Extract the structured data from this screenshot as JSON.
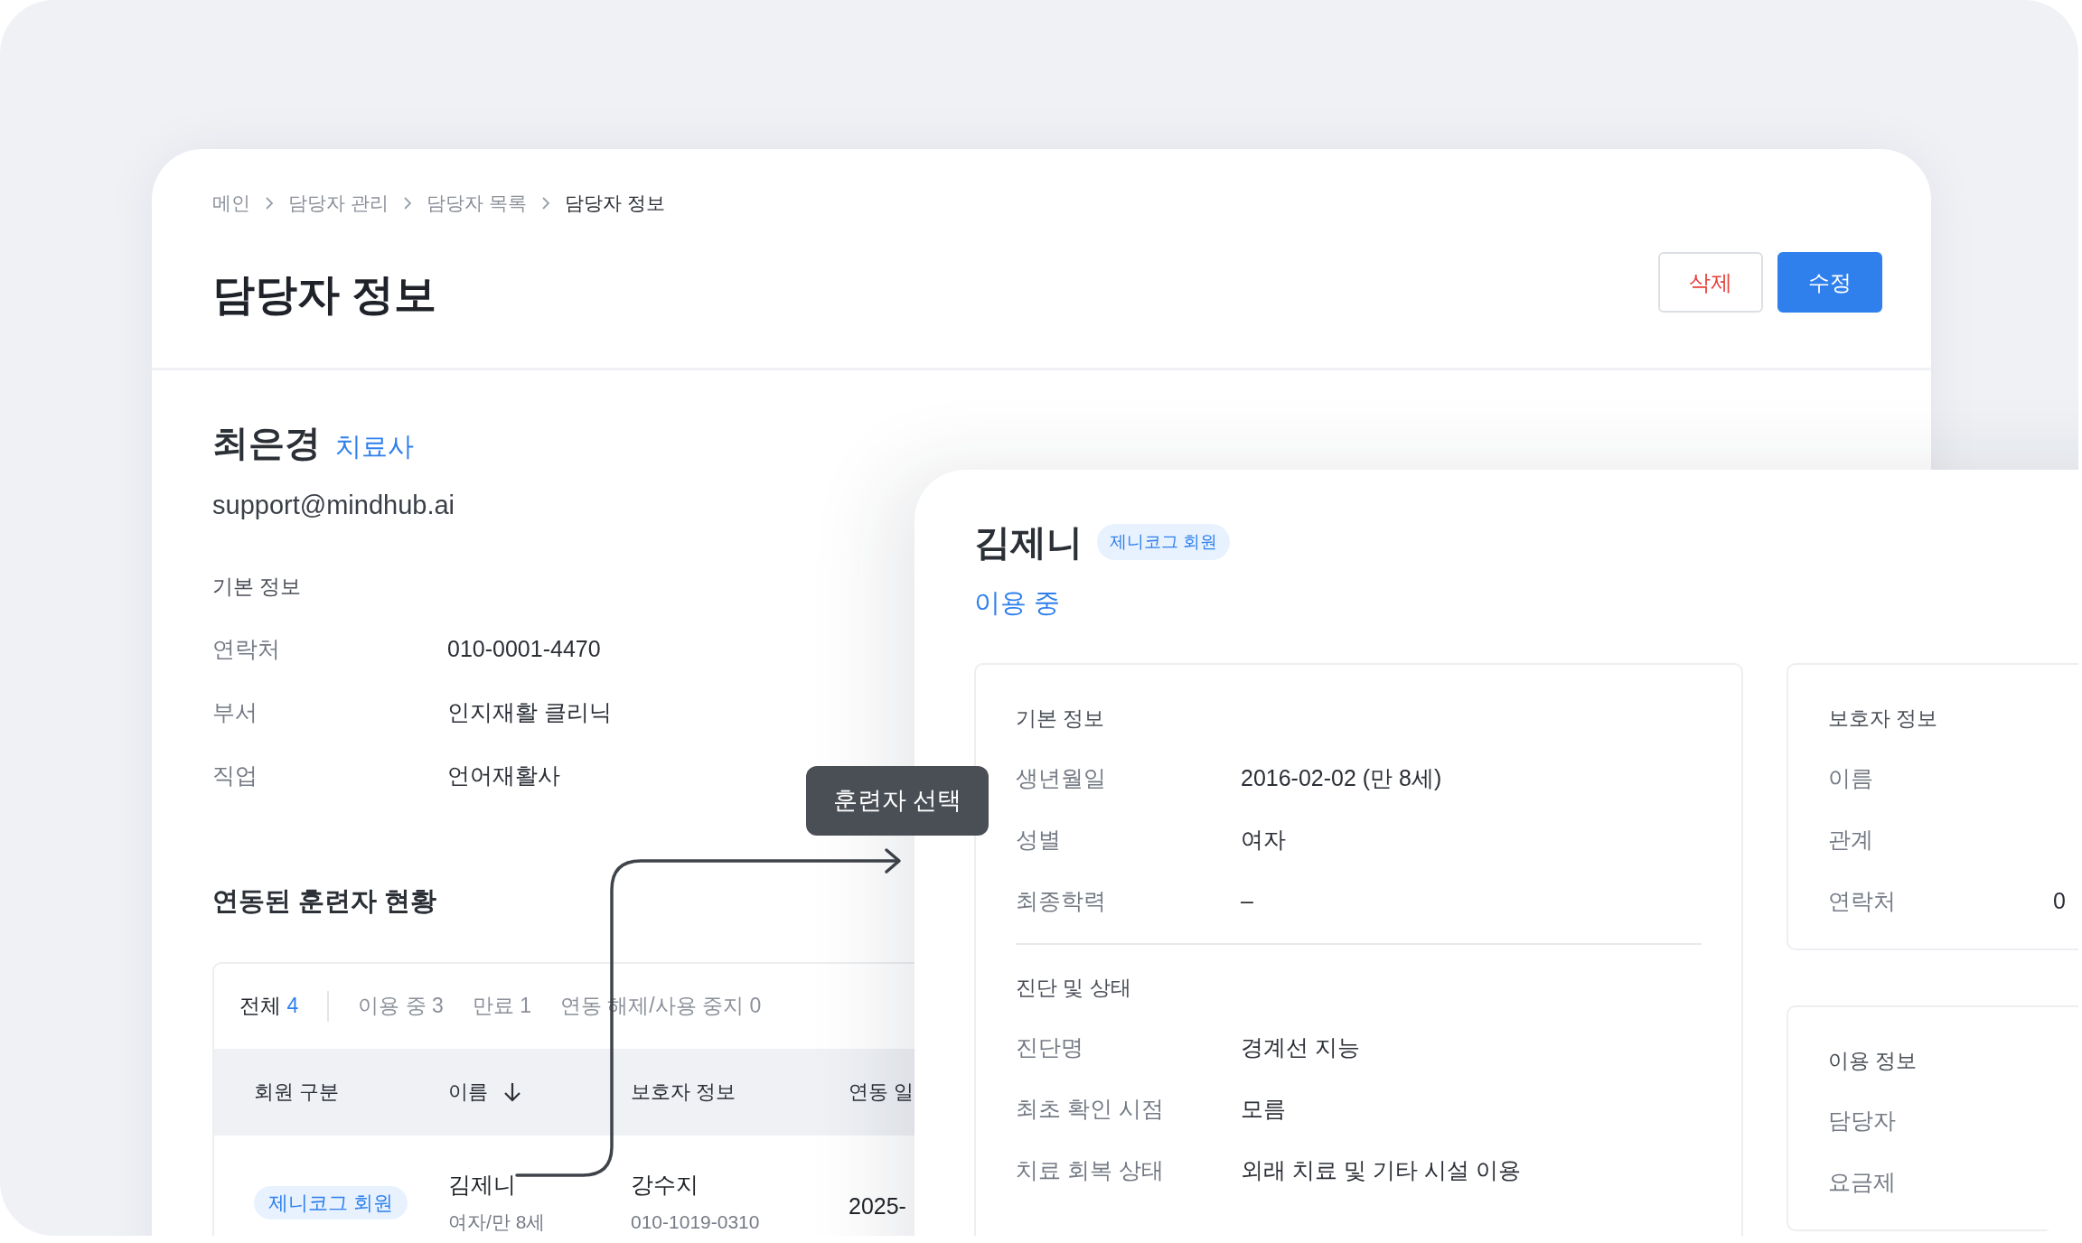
{
  "breadcrumb": [
    {
      "label": "메인",
      "current": false
    },
    {
      "label": "담당자 관리",
      "current": false
    },
    {
      "label": "담당자 목록",
      "current": false
    },
    {
      "label": "담당자 정보",
      "current": true
    }
  ],
  "page_title": "담당자 정보",
  "actions": [
    {
      "label": "삭제",
      "kind": "danger"
    },
    {
      "label": "수정",
      "kind": "primary"
    }
  ],
  "manager": {
    "name": "최은경",
    "role": "치료사",
    "email": "support@mindhub.ai",
    "section_title": "기본 정보",
    "fields": [
      {
        "label": "연락처",
        "value": "010-0001-4470"
      },
      {
        "label": "부서",
        "value": "인지재활 클리닉"
      },
      {
        "label": "직업",
        "value": "언어재활사"
      }
    ]
  },
  "linked": {
    "title": "연동된 훈련자 현황",
    "filters": [
      {
        "label": "전체",
        "count": "4",
        "selected": true
      },
      {
        "label": "이용 중",
        "count": "3",
        "selected": false
      },
      {
        "label": "만료",
        "count": "1",
        "selected": false
      },
      {
        "label": "연동 해제/사용 중지",
        "count": "0",
        "selected": false
      }
    ],
    "columns": [
      {
        "label": "회원 구분",
        "sorted": false
      },
      {
        "label": "이름",
        "sorted": true
      },
      {
        "label": "보호자 정보",
        "sorted": false
      },
      {
        "label": "연동 일",
        "sorted": false
      }
    ],
    "rows": [
      {
        "member_type": "제니코그 회원",
        "name": "김제니",
        "detail": "여자/만 8세",
        "guardian": "강수지",
        "guardian_phone": "010-1019-0310",
        "column_4": "2025-"
      }
    ]
  },
  "tooltip": "훈련자 선택",
  "detail": {
    "name": "김제니",
    "badge": "제니코그 회원",
    "status": "이용 중",
    "panels": [
      {
        "groups": [
          {
            "title": "기본 정보",
            "fields": [
              {
                "label": "생년월일",
                "value": "2016-02-02 (만 8세)"
              },
              {
                "label": "성별",
                "value": "여자"
              },
              {
                "label": "최종학력",
                "value": "–"
              }
            ]
          },
          {
            "title": "진단 및 상태",
            "fields": [
              {
                "label": "진단명",
                "value": "경계선 지능"
              },
              {
                "label": "최초 확인 시점",
                "value": "모름"
              },
              {
                "label": "치료 회복 상태",
                "value": "외래 치료 및 기타 시설 이용"
              }
            ]
          }
        ]
      },
      {
        "groups": [
          {
            "title": "보호자 정보",
            "fields": [
              {
                "label": "이름"
              },
              {
                "label": "관계"
              },
              {
                "label": "연락처",
                "value": "0"
              }
            ]
          }
        ]
      },
      {
        "groups": [
          {
            "title": "이용 정보",
            "fields": [
              {
                "label": "담당자"
              },
              {
                "label": "요금제"
              }
            ]
          }
        ]
      }
    ]
  }
}
